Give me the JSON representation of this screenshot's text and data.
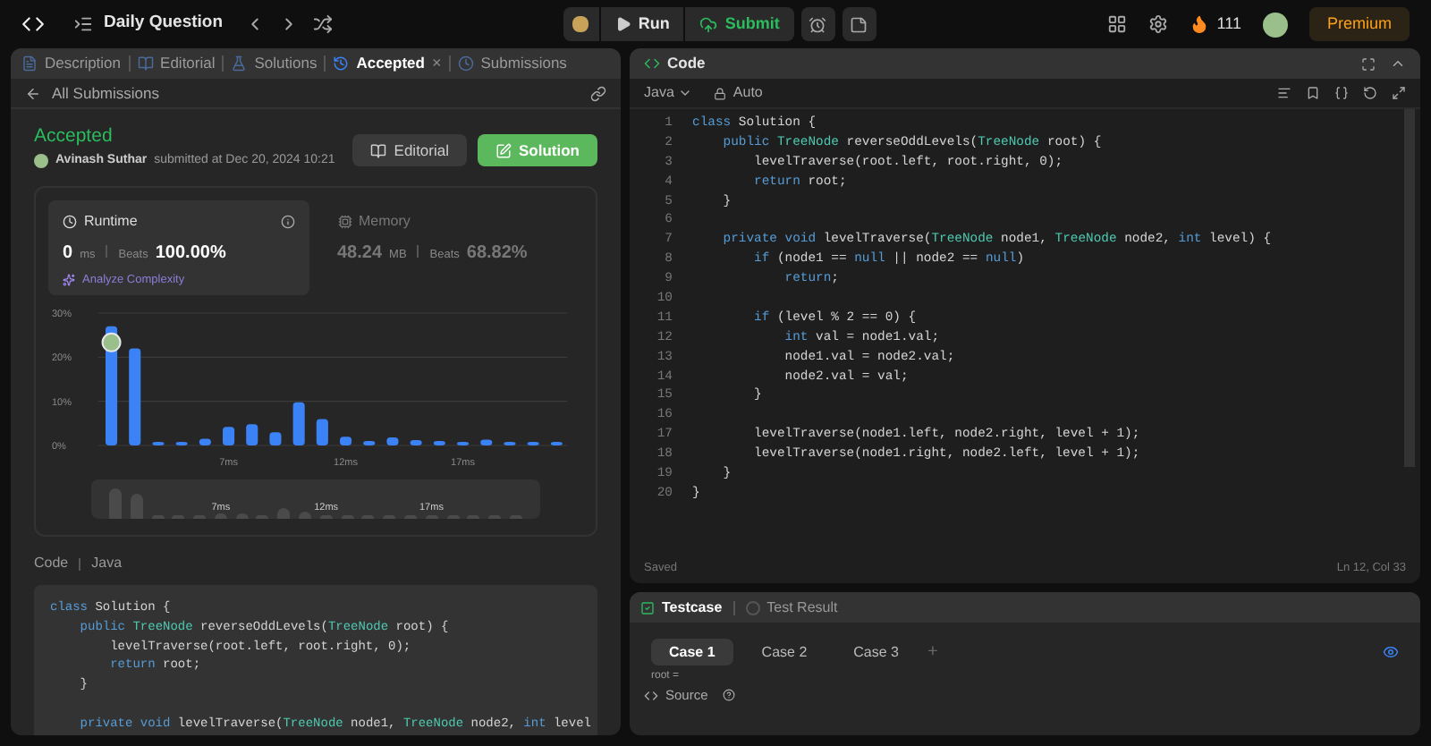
{
  "topbar": {
    "title": "Daily Question",
    "run": "Run",
    "submit": "Submit",
    "streak": "111",
    "premium": "Premium"
  },
  "left_tabs": [
    {
      "label": "Description",
      "selected": false
    },
    {
      "label": "Editorial",
      "selected": false
    },
    {
      "label": "Solutions",
      "selected": false
    },
    {
      "label": "Accepted",
      "selected": true,
      "close": "×"
    },
    {
      "label": "Submissions",
      "selected": false
    }
  ],
  "back_link": "All Submissions",
  "result": {
    "status": "Accepted",
    "author": "Avinash Suthar",
    "submitted": "submitted at Dec 20, 2024 10:21",
    "editorial_button": "Editorial",
    "solution_button": "Solution"
  },
  "stats": [
    {
      "label": "Runtime",
      "value": "0",
      "unit": "ms",
      "beats_label": "Beats",
      "beats": "100.00%",
      "selected": true
    },
    {
      "label": "Memory",
      "value": "48.24",
      "unit": "MB",
      "beats_label": "Beats",
      "beats": "68.82%",
      "selected": false
    }
  ],
  "analyze": "Analyze Complexity",
  "chart_data": {
    "type": "bar",
    "categories": [
      null,
      null,
      null,
      null,
      null,
      "7ms",
      null,
      null,
      null,
      null,
      "12ms",
      null,
      null,
      null,
      null,
      "17ms",
      null,
      null,
      null,
      null
    ],
    "values": [
      27,
      22,
      0.8,
      0.8,
      1.5,
      4.2,
      4.8,
      3,
      9.8,
      6,
      2,
      1,
      1.8,
      1.2,
      1,
      0.8,
      1.3,
      0.8,
      0.8,
      0.8
    ],
    "ylim": [
      0,
      30
    ],
    "yticks": [
      {
        "value": 0,
        "label": "0%"
      },
      {
        "value": 10,
        "label": "10%"
      },
      {
        "value": 20,
        "label": "20%"
      },
      {
        "value": 30,
        "label": "30%"
      }
    ]
  },
  "overview_labels": [
    "7ms",
    "12ms",
    "17ms"
  ],
  "code_header": {
    "title": "Code",
    "language": "Java"
  },
  "snippet": [
    {
      "kind": "code",
      "segs": [
        {
          "text": "class ",
          "kind": "keyword"
        },
        {
          "text": "Solution {",
          "kind": "plain"
        }
      ]
    },
    {
      "kind": "code",
      "segs": [
        {
          "text": "    public ",
          "kind": "keyword"
        },
        {
          "text": "TreeNode ",
          "kind": "type"
        },
        {
          "text": "reverseOddLevels(",
          "kind": "plain"
        },
        {
          "text": "TreeNode ",
          "kind": "type"
        },
        {
          "text": "root) {",
          "kind": "plain"
        }
      ]
    },
    {
      "kind": "code",
      "segs": [
        {
          "text": "        levelTraverse(root.left, root.right, 0);",
          "kind": "plain"
        }
      ]
    },
    {
      "kind": "code",
      "segs": [
        {
          "text": "        return ",
          "kind": "keyword"
        },
        {
          "text": "root;",
          "kind": "plain"
        }
      ]
    },
    {
      "kind": "code",
      "segs": [
        {
          "text": "    }",
          "kind": "plain"
        }
      ]
    },
    {
      "kind": "blank"
    },
    {
      "kind": "code",
      "segs": [
        {
          "text": "    private void ",
          "kind": "keyword"
        },
        {
          "text": "levelTraverse(",
          "kind": "plain"
        },
        {
          "text": "TreeNode ",
          "kind": "type"
        },
        {
          "text": "node1, ",
          "kind": "plain"
        },
        {
          "text": "TreeNode ",
          "kind": "type"
        },
        {
          "text": "node2, ",
          "kind": "plain"
        },
        {
          "text": "int ",
          "kind": "keyword"
        },
        {
          "text": "level",
          "kind": "plain"
        }
      ]
    }
  ],
  "editor": {
    "title": "Code",
    "language": "Java",
    "mode": "Auto",
    "saved": "Saved",
    "cursor": "Ln 12, Col 33"
  },
  "editor_lines": [
    {
      "no": "1",
      "segs": [
        {
          "text": "class ",
          "kind": "keyword"
        },
        {
          "text": "Solution {",
          "kind": "plain"
        }
      ]
    },
    {
      "no": "2",
      "segs": [
        {
          "text": "    public ",
          "kind": "keyword"
        },
        {
          "text": "TreeNode ",
          "kind": "type"
        },
        {
          "text": "reverseOddLevels(",
          "kind": "plain"
        },
        {
          "text": "TreeNode ",
          "kind": "type"
        },
        {
          "text": "root) {",
          "kind": "plain"
        }
      ]
    },
    {
      "no": "3",
      "segs": [
        {
          "text": "        levelTraverse(root.left, root.right, 0);",
          "kind": "plain"
        }
      ]
    },
    {
      "no": "4",
      "segs": [
        {
          "text": "        return ",
          "kind": "keyword"
        },
        {
          "text": "root;",
          "kind": "plain"
        }
      ]
    },
    {
      "no": "5",
      "segs": [
        {
          "text": "    }",
          "kind": "plain"
        }
      ]
    },
    {
      "no": "6"
    },
    {
      "no": "7",
      "segs": [
        {
          "text": "    private void ",
          "kind": "keyword"
        },
        {
          "text": "levelTraverse(",
          "kind": "plain"
        },
        {
          "text": "TreeNode ",
          "kind": "type"
        },
        {
          "text": "node1, ",
          "kind": "plain"
        },
        {
          "text": "TreeNode ",
          "kind": "type"
        },
        {
          "text": "node2, ",
          "kind": "plain"
        },
        {
          "text": "int ",
          "kind": "keyword"
        },
        {
          "text": "level) {",
          "kind": "plain"
        }
      ]
    },
    {
      "no": "8",
      "segs": [
        {
          "text": "        if ",
          "kind": "keyword"
        },
        {
          "text": "(node1 == ",
          "kind": "plain"
        },
        {
          "text": "null ",
          "kind": "keyword"
        },
        {
          "text": "|| node2 == ",
          "kind": "plain"
        },
        {
          "text": "null",
          "kind": "keyword"
        },
        {
          "text": ")",
          "kind": "plain"
        }
      ]
    },
    {
      "no": "9",
      "segs": [
        {
          "text": "            return",
          "kind": "keyword"
        },
        {
          "text": ";",
          "kind": "plain"
        }
      ]
    },
    {
      "no": "10"
    },
    {
      "no": "11",
      "segs": [
        {
          "text": "        if ",
          "kind": "keyword"
        },
        {
          "text": "(level % 2 == 0) {",
          "kind": "plain"
        }
      ]
    },
    {
      "no": "12",
      "segs": [
        {
          "text": "            int ",
          "kind": "keyword"
        },
        {
          "text": "val = node1.val;",
          "kind": "plain"
        }
      ]
    },
    {
      "no": "13",
      "segs": [
        {
          "text": "            node1.val = node2.val;",
          "kind": "plain"
        }
      ]
    },
    {
      "no": "14",
      "segs": [
        {
          "text": "            node2.val = val;",
          "kind": "plain"
        }
      ]
    },
    {
      "no": "15",
      "segs": [
        {
          "text": "        }",
          "kind": "plain"
        }
      ]
    },
    {
      "no": "16"
    },
    {
      "no": "17",
      "segs": [
        {
          "text": "        levelTraverse(node1.left, node2.right, level + 1);",
          "kind": "plain"
        }
      ]
    },
    {
      "no": "18",
      "segs": [
        {
          "text": "        levelTraverse(node1.right, node2.left, level + 1);",
          "kind": "plain"
        }
      ]
    },
    {
      "no": "19",
      "segs": [
        {
          "text": "    }",
          "kind": "plain"
        }
      ]
    },
    {
      "no": "20",
      "segs": [
        {
          "text": "}",
          "kind": "plain"
        }
      ]
    }
  ],
  "bottom_tabs": [
    {
      "label": "Testcase",
      "selected": true
    },
    {
      "label": "Test Result",
      "selected": false
    }
  ],
  "cases": [
    {
      "label": "Case 1",
      "selected": true
    },
    {
      "label": "Case 2",
      "selected": false
    },
    {
      "label": "Case 3",
      "selected": false
    }
  ],
  "add_case": "+",
  "input_label": "root =",
  "source": "Source"
}
